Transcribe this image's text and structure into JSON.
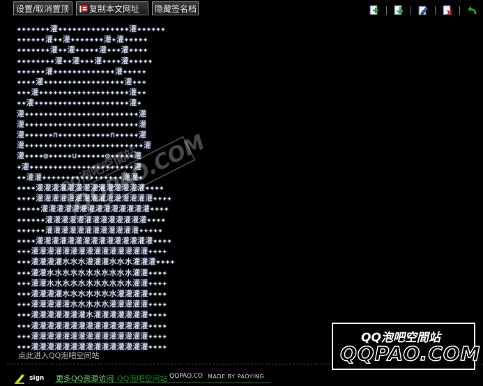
{
  "toolbar": {
    "pin_label": "设置/取消置顶",
    "copy_label": "复制本文网址",
    "hide_sig_label": "隐藏签名档",
    "icons": [
      "add-page-icon",
      "download-icon",
      "edit-icon",
      "delete-icon",
      "back-arrow-icon"
    ]
  },
  "art": {
    "text": "✦✦✦✦✦✦✦灌✦✦✦✦✦✦✦✦✦✦✦✦✦✦✦灌✦✦✦✦✦✦\n✦✦✦✦✦✦灌✦✦灌✦✦✦✦✦✦✦灌✦灌✦✦✦✦✦\n✦✦✦✦✦✦✦灌✦✦灌✦✦✦✦✦灌✦✦✦灌✦✦✦✦\n✦✦✦✦✦✦✦✦灌✦✦灌✦✦✦灌✦✦✦✦灌✦✦✦✦✦\n✦✦✦✦✦✦灌✦✦✦✦✦✦✦✦✦✦✦✦✦灌✦✦✦✦✦\n✦✦✦✦灌✦✦✦✦✦✦✦✦✦✦✦✦✦✦✦✦✦灌✦✦✦\n✦✦✦灌✦✦✦✦✦✦✦✦✦✦✦✦✦✦✦✦✦✦✦灌✦✦\n✦✦灌✦✦✦✦✦✦✦✦✦✦✦✦✦✦✦✦✦✦✦✦灌✦\n灌✦✦✦✦✦✦✦✦✦✦✦✦✦✦✦✦✦✦✦✦✦✦✦✦灌\n灌✦✦✦✦✦✦✦✦✦✦✦✦✦✦✦✦✦✦✦✦✦✦✦✦灌\n灌✦✦✦✦✦✦∩✦✦✦✦✦✦✦✦✦✦✦∩✦✦✦✦✦灌\n灌✦✦✦✦✦✦✦✦✦✦✦✦✦✦✦✦✦✦✦✦✦✦✦✦✦灌\n灌✦✦✦✦◎✦✦✦✦✦∪✦✦✦✦✦✦◎✦✦✦✦✦灌\n✦灌✦✦✦✦✦✦✦✦✦✦✦✦✦✦✦✦✦✦✦✦✦✦灌\n✦✦灌灌✦✦✦✦✦✦✦✦✦✦✦✦✦✦✦✦✦灌灌✦\n✦✦✦✦灌灌灌灌灌灌灌灌灌灌灌灌灌灌✦✦✦✦\n✦✦✦✦灌灌灌灌灌灌灌灌灌灌灌灌灌灌灌✦✦✦✦\n✦✦✦✦✦灌灌灌灌灌灌灌灌灌灌灌灌灌灌✦✦✦✦\n✦✦✦✦✦✦灌灌灌灌灌灌灌灌灌灌灌灌灌✦✦✦✦\n✦✦✦✦✦✦灌灌灌灌灌灌灌灌灌灌灌灌✦✦✦✦✦\n✦✦✦✦灌灌灌灌灌灌灌灌灌灌灌灌灌灌灌✦✦✦✦\n✦✦✦灌灌灌灌灌灌灌灌灌灌灌灌灌灌灌✦✦✦✦\n✦✦✦灌灌灌灌水水水灌灌灌水水水灌灌灌✦✦✦✦\n✦✦✦灌灌水水水水水水水水水水水灌灌✦✦✦✦\n✦✦✦灌灌水水水水水水水水水水水灌灌✦✦✦✦\n✦✦✦灌灌灌灌水水水水水水水灌灌灌灌✦✦✦✦\n✦✦✦灌灌灌灌灌水水水水水灌灌灌灌灌✦✦✦✦\n✦✦✦灌灌灌灌灌灌灌水灌灌灌灌灌灌灌✦✦✦✦\n✦✦✦灌灌灌灌灌灌灌灌灌灌灌灌灌灌灌✦✦✦✦\n✦✦✦灌灌灌灌灌灌灌灌灌灌灌灌灌灌灌✦✦✦✦\n✦✦✦灌灌灌灌灌灌灌灌灌灌灌灌灌灌灌✦✦✦✦"
  },
  "watermark": {
    "line1": "QQ泡吧空間站",
    "line2": "QQPAO.COM"
  },
  "enter_link": "点此进入QQ泡吧空间站",
  "logo": {
    "line1": "QQ泡吧空間站",
    "line2": "QQPAO.COM"
  },
  "footer": {
    "sign_label": "sign",
    "more_link": "更多QQ资源访问",
    "site_link": "QQ泡吧空间站",
    "brand": "QQPAO.CO",
    "made_by": "MADE BY PAOYING"
  }
}
